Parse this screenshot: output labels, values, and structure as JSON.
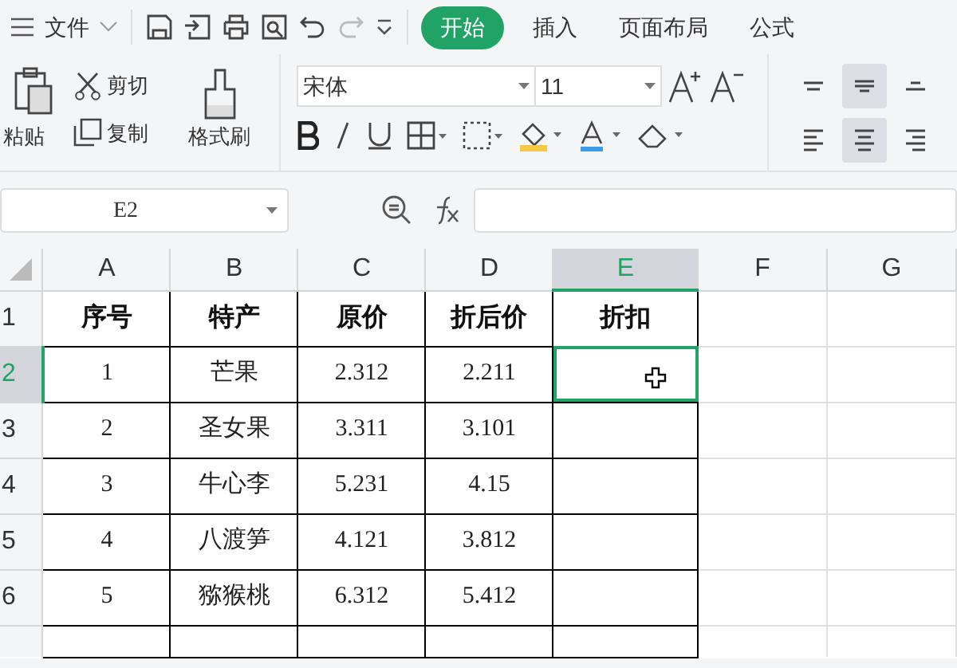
{
  "toolbar": {
    "file_menu": "文件"
  },
  "tabs": [
    {
      "label": "开始",
      "selected": true
    },
    {
      "label": "插入",
      "selected": false
    },
    {
      "label": "页面布局",
      "selected": false
    },
    {
      "label": "公式",
      "selected": false
    }
  ],
  "ribbon": {
    "paste": "粘贴",
    "cut": "剪切",
    "copy": "复制",
    "format_painter": "格式刷",
    "font_name": "宋体",
    "font_size": "11",
    "align_top": [
      {
        "kind": "top",
        "selected": false
      },
      {
        "kind": "middle",
        "selected": true
      },
      {
        "kind": "bottom",
        "selected": false
      }
    ],
    "align_horizontal": [
      {
        "kind": "left",
        "selected": false
      },
      {
        "kind": "center",
        "selected": true
      },
      {
        "kind": "right",
        "selected": false
      }
    ]
  },
  "formula_bar": {
    "name_box": "E2"
  },
  "sheet": {
    "columns": [
      {
        "label": "A",
        "selected": false
      },
      {
        "label": "B",
        "selected": false
      },
      {
        "label": "C",
        "selected": false
      },
      {
        "label": "D",
        "selected": false
      },
      {
        "label": "E",
        "selected": true
      },
      {
        "label": "F",
        "selected": false
      },
      {
        "label": "G",
        "selected": false
      }
    ],
    "rows": [
      {
        "label": "1",
        "selected": false,
        "header": true,
        "cells": [
          "序号",
          "特产",
          "原价",
          "折后价",
          "折扣"
        ]
      },
      {
        "label": "2",
        "selected": true,
        "header": false,
        "cells": [
          "1",
          "芒果",
          "2.312",
          "2.211",
          ""
        ]
      },
      {
        "label": "3",
        "selected": false,
        "header": false,
        "cells": [
          "2",
          "圣女果",
          "3.311",
          "3.101",
          ""
        ]
      },
      {
        "label": "4",
        "selected": false,
        "header": false,
        "cells": [
          "3",
          "牛心李",
          "5.231",
          "4.15",
          ""
        ]
      },
      {
        "label": "5",
        "selected": false,
        "header": false,
        "cells": [
          "4",
          "八渡笋",
          "4.121",
          "3.812",
          ""
        ]
      },
      {
        "label": "6",
        "selected": false,
        "header": false,
        "cells": [
          "5",
          "猕猴桃",
          "6.312",
          "5.412",
          ""
        ]
      }
    ]
  }
}
